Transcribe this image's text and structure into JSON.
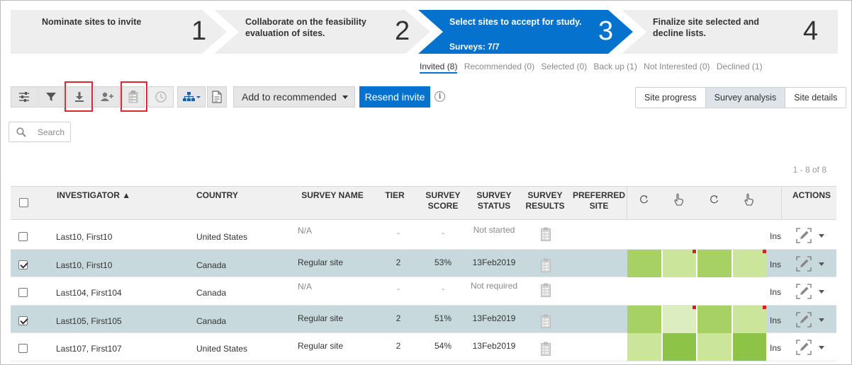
{
  "stepper": {
    "steps": [
      {
        "label": "Nominate sites to invite",
        "number": "1",
        "sub": ""
      },
      {
        "label": "Collaborate on the feasibility evaluation of sites.",
        "number": "2",
        "sub": ""
      },
      {
        "label": "Select sites to accept for study.",
        "number": "3",
        "sub": "Surveys: 7/7"
      },
      {
        "label": "Finalize site selected and decline lists.",
        "number": "4",
        "sub": ""
      }
    ],
    "colors": {
      "inactive": "#eeeeee",
      "active": "#0572ce"
    }
  },
  "status_tabs": [
    {
      "label": "Invited (8)"
    },
    {
      "label": "Recommended (0)"
    },
    {
      "label": "Selected (0)"
    },
    {
      "label": "Back up (1)"
    },
    {
      "label": "Not Interested (0)"
    },
    {
      "label": "Declined (1)"
    }
  ],
  "toolbar": {
    "icons": [
      "settings-sliders-icon",
      "filter-icon",
      "download-icon",
      "add-user-icon",
      "survey-clipboard-icon",
      "clock-icon",
      "hierarchy-icon",
      "document-icon"
    ],
    "action_select": "Add to recommended",
    "primary_label": "Resend invite",
    "info_glyph": "i"
  },
  "view_buttons": [
    "Site progress",
    "Survey analysis",
    "Site details"
  ],
  "search": {
    "placeholder": "Search"
  },
  "pager": "1 - 8 of 8",
  "table": {
    "headers": {
      "investigator": "INVESTIGATOR ▲",
      "country": "COUNTRY",
      "survey_name": "SURVEY NAME",
      "tier": "TIER",
      "survey_score_1": "SURVEY",
      "survey_score_2": "SCORE",
      "survey_status_1": "SURVEY",
      "survey_status_2": "STATUS",
      "survey_results_1": "SURVEY",
      "survey_results_2": "RESULTS",
      "preferred_1": "PREFERRED",
      "preferred_2": "SITE",
      "actions": "ACTIONS"
    },
    "rows": [
      {
        "investigator": "Last10, First10",
        "country": "United States",
        "survey": "N/A",
        "tier": "-",
        "score": "-",
        "status": "Not started",
        "checked": false,
        "ins": "Ins",
        "heat": []
      },
      {
        "investigator": "Last10, First10",
        "country": "Canada",
        "survey": "Regular site",
        "tier": "2",
        "score": "53%",
        "status": "13Feb2019",
        "checked": true,
        "ins": "Ins",
        "heat": [
          "#a7d065",
          "#cbe59a",
          "#a7d065",
          "#cbe59a"
        ]
      },
      {
        "investigator": "Last104, First104",
        "country": "Canada",
        "survey": "N/A",
        "tier": "-",
        "score": "-",
        "status": "Not required",
        "checked": false,
        "ins": "Ins",
        "heat": []
      },
      {
        "investigator": "Last105, First105",
        "country": "Canada",
        "survey": "Regular site",
        "tier": "2",
        "score": "51%",
        "status": "13Feb2019",
        "checked": true,
        "ins": "Ins",
        "heat": [
          "#a7d065",
          "#dcedc0",
          "#a7d065",
          "#cbe59a"
        ]
      },
      {
        "investigator": "Last107, First107",
        "country": "United States",
        "survey": "Regular site",
        "tier": "2",
        "score": "54%",
        "status": "13Feb2019",
        "checked": false,
        "ins": "Ins",
        "heat": [
          "#cbe59a",
          "#8dc447",
          "#cbe59a",
          "#8dc447"
        ]
      }
    ]
  }
}
